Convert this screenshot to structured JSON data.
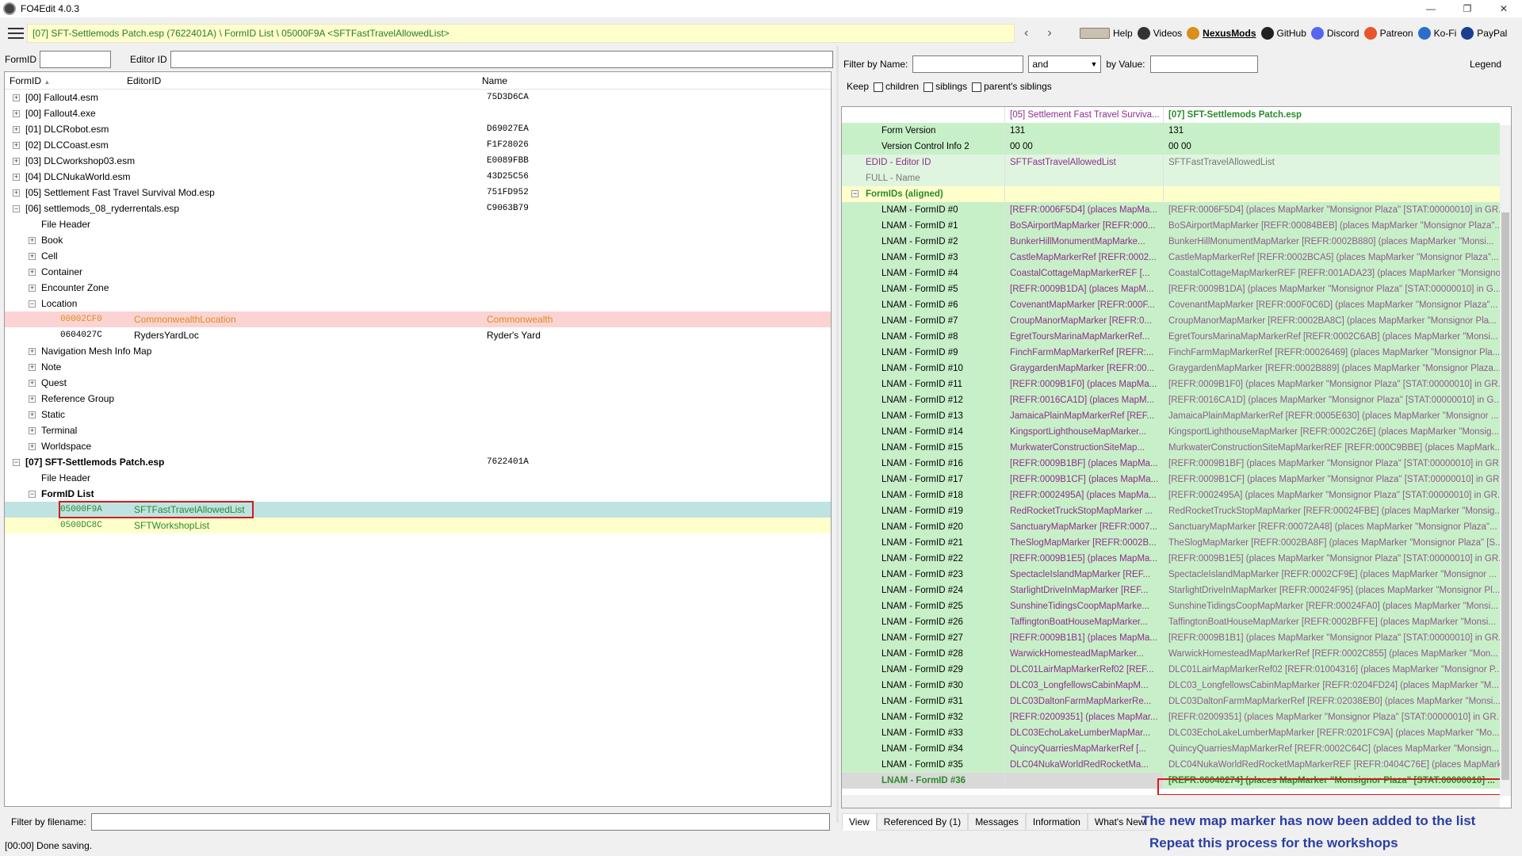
{
  "window": {
    "title": "FO4Edit 4.0.3",
    "btn_min": "—",
    "btn_restore": "❐",
    "btn_close": "✕"
  },
  "path": "[07] SFT-Settlemods Patch.esp (7622401A) \\ FormID List \\ 05000F9A <SFTFastTravelAllowedList>",
  "nav": {
    "back": "‹",
    "forward": "›"
  },
  "toplinks": [
    {
      "label": "Help",
      "icon": "help-icon",
      "color": "#555555"
    },
    {
      "label": "Videos",
      "icon": "videos-icon",
      "color": "#333333"
    },
    {
      "label": "NexusMods",
      "icon": "nexus-icon",
      "color": "#d98f1b"
    },
    {
      "label": "GitHub",
      "icon": "github-icon",
      "color": "#222222"
    },
    {
      "label": "Discord",
      "icon": "discord-icon",
      "color": "#5865f2"
    },
    {
      "label": "Patreon",
      "icon": "patreon-icon",
      "color": "#e8542e"
    },
    {
      "label": "Ko-Fi",
      "icon": "kofi-icon",
      "color": "#2a6ec9"
    },
    {
      "label": "PayPal",
      "icon": "paypal-icon",
      "color": "#1b3f8f"
    }
  ],
  "left": {
    "formid_label": "FormID",
    "formid_value": "",
    "editorid_label": "Editor ID",
    "editorid_value": "",
    "columns": {
      "formid": "FormID",
      "sort_glyph": "▲",
      "editorid": "EditorID",
      "name": "Name"
    },
    "filter_label": "Filter by filename:",
    "filter_value": "",
    "status": "[00:00] Done saving."
  },
  "tree_rows": [
    {
      "id": "[00] Fallout4.esm",
      "name": "75D3D6CA",
      "level": 0,
      "toggle": "+"
    },
    {
      "id": "[00] Fallout4.exe",
      "name": "",
      "level": 0,
      "toggle": "+"
    },
    {
      "id": "[01] DLCRobot.esm",
      "name": "D69027EA",
      "level": 0,
      "toggle": "+"
    },
    {
      "id": "[02] DLCCoast.esm",
      "name": "F1F28026",
      "level": 0,
      "toggle": "+"
    },
    {
      "id": "[03] DLCworkshop03.esm",
      "name": "E0089FBB",
      "level": 0,
      "toggle": "+"
    },
    {
      "id": "[04] DLCNukaWorld.esm",
      "name": "43D25C56",
      "level": 0,
      "toggle": "+"
    },
    {
      "id": "[05] Settlement Fast Travel Survival Mod.esp",
      "name": "751FD952",
      "level": 0,
      "toggle": "+"
    },
    {
      "id": "[06] settlemods_08_ryderrentals.esp",
      "name": "C9063B79",
      "level": 0,
      "toggle": "−"
    },
    {
      "id": "File Header",
      "name": "",
      "level": 1,
      "toggle": ""
    },
    {
      "id": "Book",
      "name": "",
      "level": 1,
      "toggle": "+"
    },
    {
      "id": "Cell",
      "name": "",
      "level": 1,
      "toggle": "+"
    },
    {
      "id": "Container",
      "name": "",
      "level": 1,
      "toggle": "+"
    },
    {
      "id": "Encounter Zone",
      "name": "",
      "level": 1,
      "toggle": "+"
    },
    {
      "id": "Location",
      "name": "",
      "level": 1,
      "toggle": "−"
    },
    {
      "id": "00002CF0",
      "editor": "CommonwealthLocation",
      "name": "Commonwealth",
      "level": 2,
      "toggle": "",
      "style": "sel-red"
    },
    {
      "id": "0604027C",
      "editor": "RydersYardLoc",
      "name": "Ryder's Yard",
      "level": 2,
      "toggle": ""
    },
    {
      "id": "Navigation Mesh Info Map",
      "name": "",
      "level": 1,
      "toggle": "+"
    },
    {
      "id": "Note",
      "name": "",
      "level": 1,
      "toggle": "+"
    },
    {
      "id": "Quest",
      "name": "",
      "level": 1,
      "toggle": "+"
    },
    {
      "id": "Reference Group",
      "name": "",
      "level": 1,
      "toggle": "+"
    },
    {
      "id": "Static",
      "name": "",
      "level": 1,
      "toggle": "+"
    },
    {
      "id": "Terminal",
      "name": "",
      "level": 1,
      "toggle": "+"
    },
    {
      "id": "Worldspace",
      "name": "",
      "level": 1,
      "toggle": "+"
    },
    {
      "id": "[07] SFT-Settlemods Patch.esp",
      "name": "7622401A",
      "level": 0,
      "toggle": "−",
      "bold": true
    },
    {
      "id": "File Header",
      "name": "",
      "level": 1,
      "toggle": ""
    },
    {
      "id": "FormID List",
      "name": "",
      "level": 1,
      "toggle": "−",
      "bold": true
    },
    {
      "id": "05000F9A",
      "editor": "SFTFastTravelAllowedList",
      "name": "",
      "level": 2,
      "toggle": "",
      "style": "sel-cyan"
    },
    {
      "id": "0500DC8C",
      "editor": "SFTWorkshopList",
      "name": "",
      "level": 2,
      "toggle": "",
      "style": "yellow"
    }
  ],
  "right": {
    "filter_name_label": "Filter by Name:",
    "filter_name_value": "",
    "and_select": "and",
    "filter_value_label": "by Value:",
    "filter_value_value": "",
    "legend": "Legend",
    "keep_label": "Keep",
    "keep_children": "children",
    "keep_siblings": "siblings",
    "keep_parents_siblings": "parent's siblings",
    "col_header_1": "[05] Settlement Fast Travel Surviva...",
    "col_header_2": "[07] SFT-Settlemods Patch.esp"
  },
  "record_rows": [
    {
      "label": "Form Version",
      "v1": "131",
      "v2": "131",
      "style": "green",
      "indent": 2
    },
    {
      "label": "Version Control Info 2",
      "v1": "00 00",
      "v2": "00 00",
      "style": "green",
      "indent": 2
    },
    {
      "label": "EDID - Editor ID",
      "v1": "SFTFastTravelAllowedList",
      "v2": "SFTFastTravelAllowedList",
      "style": "green2",
      "indent": 1,
      "purple": true
    },
    {
      "label": "FULL - Name",
      "v1": "",
      "v2": "",
      "style": "green2",
      "indent": 1,
      "gray": true
    },
    {
      "label": "FormIDs (aligned)",
      "v1": "",
      "v2": "",
      "style": "yellowish",
      "indent": 0,
      "toggle": "−",
      "bold": true
    }
  ],
  "lnam_rows": [
    {
      "label": "LNAM - FormID #0",
      "v1": "[REFR:0006F5D4] (places MapMa...",
      "v2": "[REFR:0006F5D4] (places MapMarker \"Monsignor Plaza\" [STAT:00000010] in GR..."
    },
    {
      "label": "LNAM - FormID #1",
      "v1": "BoSAirportMapMarker [REFR:000...",
      "v2": "BoSAirportMapMarker [REFR:00084BEB] (places MapMarker \"Monsignor Plaza\"..."
    },
    {
      "label": "LNAM - FormID #2",
      "v1": "BunkerHillMonumentMapMarke...",
      "v2": "BunkerHillMonumentMapMarker [REFR:0002B880] (places MapMarker \"Monsi..."
    },
    {
      "label": "LNAM - FormID #3",
      "v1": "CastleMapMarkerRef [REFR:0002...",
      "v2": "CastleMapMarkerRef [REFR:0002BCA5] (places MapMarker \"Monsignor Plaza\"..."
    },
    {
      "label": "LNAM - FormID #4",
      "v1": "CoastalCottageMapMarkerREF [...",
      "v2": "CoastalCottageMapMarkerREF [REFR:001ADA23] (places MapMarker \"Monsigno..."
    },
    {
      "label": "LNAM - FormID #5",
      "v1": "[REFR:0009B1DA] (places MapM...",
      "v2": "[REFR:0009B1DA] (places MapMarker \"Monsignor Plaza\" [STAT:00000010] in G..."
    },
    {
      "label": "LNAM - FormID #6",
      "v1": "CovenantMapMarker [REFR:000F...",
      "v2": "CovenantMapMarker [REFR:000F0C6D] (places MapMarker \"Monsignor Plaza\"..."
    },
    {
      "label": "LNAM - FormID #7",
      "v1": "CroupManorMapMarker [REFR:0...",
      "v2": "CroupManorMapMarker [REFR:0002BA8C] (places MapMarker \"Monsignor Pla..."
    },
    {
      "label": "LNAM - FormID #8",
      "v1": "EgretToursMarinaMapMarkerRef...",
      "v2": "EgretToursMarinaMapMarkerRef [REFR:0002C6AB] (places MapMarker \"Monsi..."
    },
    {
      "label": "LNAM - FormID #9",
      "v1": "FinchFarmMapMarkerRef [REFR:...",
      "v2": "FinchFarmMapMarkerRef [REFR:00026469] (places MapMarker \"Monsignor Pla..."
    },
    {
      "label": "LNAM - FormID #10",
      "v1": "GraygardenMapMarker [REFR:00...",
      "v2": "GraygardenMapMarker [REFR:0002B889] (places MapMarker \"Monsignor Plaza..."
    },
    {
      "label": "LNAM - FormID #11",
      "v1": "[REFR:0009B1F0] (places MapMa...",
      "v2": "[REFR:0009B1F0] (places MapMarker \"Monsignor Plaza\" [STAT:00000010] in GR..."
    },
    {
      "label": "LNAM - FormID #12",
      "v1": "[REFR:0016CA1D] (places MapM...",
      "v2": "[REFR:0016CA1D] (places MapMarker \"Monsignor Plaza\" [STAT:00000010] in G..."
    },
    {
      "label": "LNAM - FormID #13",
      "v1": "JamaicaPlainMapMarkerRef [REF...",
      "v2": "JamaicaPlainMapMarkerRef [REFR:0005E630] (places MapMarker \"Monsignor ..."
    },
    {
      "label": "LNAM - FormID #14",
      "v1": "KingsportLighthouseMapMarker...",
      "v2": "KingsportLighthouseMapMarker [REFR:0002C26E] (places MapMarker \"Monsig..."
    },
    {
      "label": "LNAM - FormID #15",
      "v1": "MurkwaterConstructionSiteMap...",
      "v2": "MurkwaterConstructionSiteMapMarkerREF [REFR:000C9BBE] (places MapMark..."
    },
    {
      "label": "LNAM - FormID #16",
      "v1": "[REFR:0009B1BF] (places MapMa...",
      "v2": "[REFR:0009B1BF] (places MapMarker \"Monsignor Plaza\" [STAT:00000010] in GR..."
    },
    {
      "label": "LNAM - FormID #17",
      "v1": "[REFR:0009B1CF] (places MapMa...",
      "v2": "[REFR:0009B1CF] (places MapMarker \"Monsignor Plaza\" [STAT:00000010] in GR..."
    },
    {
      "label": "LNAM - FormID #18",
      "v1": "[REFR:0002495A] (places MapMa...",
      "v2": "[REFR:0002495A] (places MapMarker \"Monsignor Plaza\" [STAT:00000010] in GR..."
    },
    {
      "label": "LNAM - FormID #19",
      "v1": "RedRocketTruckStopMapMarker ...",
      "v2": "RedRocketTruckStopMapMarker [REFR:00024FBE] (places MapMarker \"Monsig..."
    },
    {
      "label": "LNAM - FormID #20",
      "v1": "SanctuaryMapMarker [REFR:0007...",
      "v2": "SanctuaryMapMarker [REFR:00072A48] (places MapMarker \"Monsignor Plaza\"..."
    },
    {
      "label": "LNAM - FormID #21",
      "v1": "TheSlogMapMarker [REFR:0002B...",
      "v2": "TheSlogMapMarker [REFR:0002BA8F] (places MapMarker \"Monsignor Plaza\" [S..."
    },
    {
      "label": "LNAM - FormID #22",
      "v1": "[REFR:0009B1E5] (places MapMa...",
      "v2": "[REFR:0009B1E5] (places MapMarker \"Monsignor Plaza\" [STAT:00000010] in GR..."
    },
    {
      "label": "LNAM - FormID #23",
      "v1": "SpectacleIslandMapMarker [REF...",
      "v2": "SpectacleIslandMapMarker [REFR:0002CF9E] (places MapMarker \"Monsignor ..."
    },
    {
      "label": "LNAM - FormID #24",
      "v1": "StarlightDriveInMapMarker [REF...",
      "v2": "StarlightDriveInMapMarker [REFR:00024F95] (places MapMarker \"Monsignor Pl..."
    },
    {
      "label": "LNAM - FormID #25",
      "v1": "SunshineTidingsCoopMapMarke...",
      "v2": "SunshineTidingsCoopMapMarker [REFR:00024FA0] (places MapMarker \"Monsi..."
    },
    {
      "label": "LNAM - FormID #26",
      "v1": "TaffingtonBoatHouseMapMarker...",
      "v2": "TaffingtonBoatHouseMapMarker [REFR:0002BFFE] (places MapMarker \"Monsi..."
    },
    {
      "label": "LNAM - FormID #27",
      "v1": "[REFR:0009B1B1] (places MapMa...",
      "v2": "[REFR:0009B1B1] (places MapMarker \"Monsignor Plaza\" [STAT:00000010] in GR..."
    },
    {
      "label": "LNAM - FormID #28",
      "v1": "WarwickHomesteadMapMarker...",
      "v2": "WarwickHomesteadMapMarkerRef [REFR:0002C855] (places MapMarker \"Mon..."
    },
    {
      "label": "LNAM - FormID #29",
      "v1": "DLC01LairMapMarkerRef02 [REF...",
      "v2": "DLC01LairMapMarkerRef02 [REFR:01004316] (places MapMarker \"Monsignor P..."
    },
    {
      "label": "LNAM - FormID #30",
      "v1": "DLC03_LongfellowsCabinMapM...",
      "v2": "DLC03_LongfellowsCabinMapMarker [REFR:0204FD24] (places MapMarker \"M..."
    },
    {
      "label": "LNAM - FormID #31",
      "v1": "DLC03DaltonFarmMapMarkerRe...",
      "v2": "DLC03DaltonFarmMapMarkerRef [REFR:02038EB0] (places MapMarker \"Monsi..."
    },
    {
      "label": "LNAM - FormID #32",
      "v1": "[REFR:02009351] (places MapMar...",
      "v2": "[REFR:02009351] (places MapMarker \"Monsignor Plaza\" [STAT:00000010] in GR..."
    },
    {
      "label": "LNAM - FormID #33",
      "v1": "DLC03EchoLakeLumberMapMar...",
      "v2": "DLC03EchoLakeLumberMapMarker [REFR:0201FC9A] (places MapMarker \"Mo..."
    },
    {
      "label": "LNAM - FormID #34",
      "v1": "QuincyQuarriesMapMarkerRef [...",
      "v2": "QuincyQuarriesMapMarkerRef [REFR:0002C64C] (places MapMarker \"Monsign..."
    },
    {
      "label": "LNAM - FormID #35",
      "v1": "DLC04NukaWorldRedRocketMa...",
      "v2": "DLC04NukaWorldRedRocketMapMarkerREF [REFR:0404C76E] (places MapMark..."
    }
  ],
  "new_row": {
    "label": "LNAM - FormID #36",
    "v1": "",
    "v2": "[REFR:06040274] (places MapMarker \"Monsignor Plaza\" [STAT:00000010] ..."
  },
  "tabs": [
    "View",
    "Referenced By (1)",
    "Messages",
    "Information",
    "What's New"
  ],
  "captions": [
    "The new map marker has now been added to the list",
    "Repeat this process for the workshops"
  ],
  "colors": {
    "green_row": "#c8f0c8",
    "selection_cyan": "#bfe3e3",
    "selection_red": "#fbd3d3",
    "highlight_box": "#d01c1c",
    "caption": "#2b3ea3"
  }
}
